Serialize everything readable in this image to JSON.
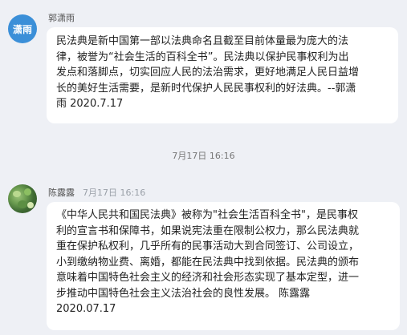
{
  "messages": [
    {
      "avatar_text": "潇雨",
      "sender": "郭潇雨",
      "time": "",
      "lines": [
        "民法典是新中国第一部以法典命名且截至目前体量最为庞大的法",
        "律，被誉为“社会生活的百科全书”。民法典以保护民事权利为出",
        "发点和落脚点，切实回应人民的法治需求，更好地满足人民日益增",
        "长的美好生活需要，是新时代保护人民民事权利的好法典。--郭潇",
        "雨 2020.7.17"
      ]
    },
    {
      "avatar_text": "",
      "sender": "陈露露",
      "time": "7月17日 16:16",
      "lines": [
        "《中华人民共和国民法典》被称为\"社会生活百科全书\"，是民事权",
        "利的宣言书和保障书，如果说宪法重在限制公权力，那么民法典就",
        "重在保护私权利，几乎所有的民事活动大到合同签订、公司设立，",
        "小到缴纳物业费、离婚，都能在民法典中找到依据。民法典的颁布",
        "意味着中国特色社会主义的经济和社会形态实现了基本定型，进一",
        "步推动中国特色社会主义法治社会的良性发展。          陈露露",
        "2020.07.17"
      ]
    }
  ],
  "timestamp_divider": "7月17日 16:16"
}
